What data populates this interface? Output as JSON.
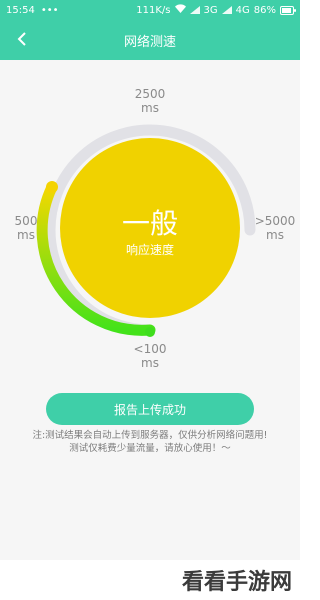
{
  "status": {
    "time": "15:54",
    "dots": "•••",
    "speed": "111K/s",
    "net1": "3G",
    "net2": "4G",
    "battery_text": "86%",
    "battery_level": 0.86
  },
  "header": {
    "back_icon": "chevron-left-icon",
    "title": "网络测速"
  },
  "gauge": {
    "top_label_value": "2500",
    "top_label_unit": "ms",
    "left_label_value": "500",
    "left_label_unit": "ms",
    "right_label_value": ">5000",
    "right_label_unit": "ms",
    "bottom_label_value": "<100",
    "bottom_label_unit": "ms",
    "rating": "一般",
    "rating_caption": "响应速度",
    "colors": {
      "track": "#e1e1e6",
      "progress_start": "#43e21a",
      "progress_end": "#f4d800",
      "center": "#f0d200"
    }
  },
  "action": {
    "button_label": "报告上传成功"
  },
  "note": {
    "line1": "注:测试结果会自动上传到服务器，仅供分析网络问题用!",
    "line2": "测试仅耗费少量流量，请放心使用！～"
  },
  "watermark": "看看手游网"
}
